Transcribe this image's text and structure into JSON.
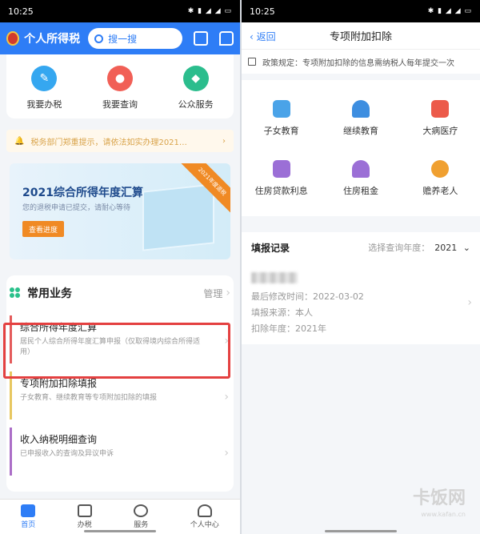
{
  "status": {
    "time": "10:25",
    "icons": "✱ ▮ ◢ ◢ ▭"
  },
  "left": {
    "app_title": "个人所得税",
    "search_placeholder": "搜一搜",
    "quick_actions": [
      {
        "label": "我要办税",
        "icon": "pen-icon",
        "color": "#35a7f0"
      },
      {
        "label": "我要查询",
        "icon": "search-icon",
        "color": "#f15f56"
      },
      {
        "label": "公众服务",
        "icon": "shield-icon",
        "color": "#2bbd8d"
      }
    ],
    "notice": "税务部门郑重提示，请依法如实办理2021…",
    "banner": {
      "title": "2021综合所得年度汇算",
      "subtitle": "您的退税申请已提交，请耐心等待",
      "button": "查看进度",
      "ribbon": "2021年度退税"
    },
    "section": {
      "title": "常用业务",
      "manage": "管理"
    },
    "business": [
      {
        "title": "综合所得年度汇算",
        "desc": "居民个人综合所得年度汇算申报（仅取得境内综合所得适用）"
      },
      {
        "title": "专项附加扣除填报",
        "desc": "子女教育、继续教育等专项附加扣除的填报"
      },
      {
        "title": "收入纳税明细查询",
        "desc": "已申报收入的查询及异议申诉"
      }
    ],
    "tabs": [
      {
        "label": "首页",
        "active": true
      },
      {
        "label": "办税",
        "active": false
      },
      {
        "label": "服务",
        "active": false
      },
      {
        "label": "个人中心",
        "active": false
      }
    ]
  },
  "right": {
    "back": "返回",
    "title": "专项附加扣除",
    "policy": "政策规定：专项附加扣除的信息需纳税人每年提交一次",
    "items": [
      {
        "label": "子女教育",
        "color": "#4aa3e8"
      },
      {
        "label": "继续教育",
        "color": "#3d8ee0"
      },
      {
        "label": "大病医疗",
        "color": "#ec5a4a"
      },
      {
        "label": "住房贷款利息",
        "color": "#9b6fd6"
      },
      {
        "label": "住房租金",
        "color": "#9b6fd6"
      },
      {
        "label": "赡养老人",
        "color": "#f0a030"
      }
    ],
    "records": {
      "title": "填报记录",
      "year_label": "选择查询年度：",
      "year": "2021",
      "modified": "最后修改时间：2022-03-02",
      "source": "填报来源：本人",
      "deduct_year": "扣除年度：2021年"
    },
    "watermark": "卡饭网",
    "watermark_url": "www.kafan.cn"
  }
}
